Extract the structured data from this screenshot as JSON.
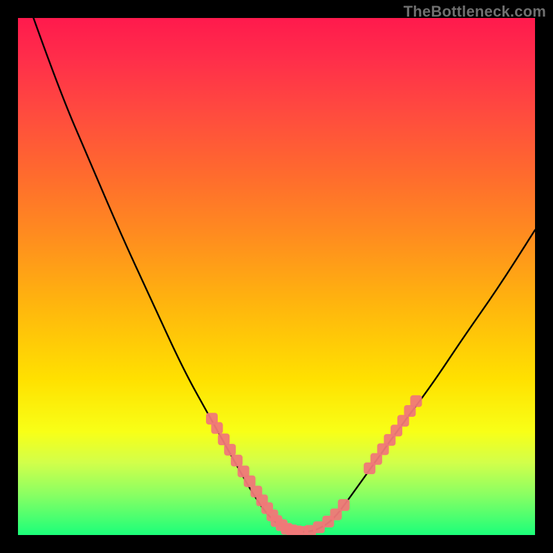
{
  "watermark": "TheBottleneck.com",
  "chart_data": {
    "type": "line",
    "title": "",
    "xlabel": "",
    "ylabel": "",
    "xlim": [
      0,
      100
    ],
    "ylim": [
      0,
      100
    ],
    "series": [
      {
        "name": "main-curve",
        "x": [
          3,
          8,
          14,
          20,
          26,
          32,
          37,
          42,
          46,
          49,
          52,
          55,
          58,
          61,
          64,
          69,
          74,
          80,
          86,
          93,
          100
        ],
        "y": [
          100,
          86,
          72,
          58,
          45,
          32,
          23,
          14,
          7,
          3,
          1,
          0.5,
          1,
          3,
          7,
          14,
          21,
          29,
          38,
          48,
          59
        ]
      },
      {
        "name": "highlight-dots-left",
        "x": [
          37.5,
          38.5,
          39.8,
          41.0,
          42.3,
          43.6,
          44.8,
          46.1,
          47.2,
          48.2,
          49.2
        ],
        "y": [
          22.5,
          20.7,
          18.5,
          16.5,
          14.4,
          12.3,
          10.4,
          8.4,
          6.7,
          5.2,
          3.8
        ]
      },
      {
        "name": "highlight-dots-bottom",
        "x": [
          50.0,
          51.0,
          52.0,
          53.0,
          54.0,
          55.0,
          56.5,
          58.2,
          60.0,
          61.5,
          63.0
        ],
        "y": [
          2.7,
          1.9,
          1.2,
          0.9,
          0.7,
          0.6,
          0.8,
          1.5,
          2.6,
          4.0,
          5.8
        ]
      },
      {
        "name": "highlight-dots-right",
        "x": [
          68.0,
          69.3,
          70.6,
          71.9,
          73.2,
          74.5,
          75.8,
          77.0
        ],
        "y": [
          12.9,
          14.7,
          16.6,
          18.4,
          20.2,
          22.1,
          24.0,
          25.9
        ]
      }
    ],
    "colors": {
      "curve_stroke": "#000000",
      "dot_fill": "#f07878"
    }
  }
}
